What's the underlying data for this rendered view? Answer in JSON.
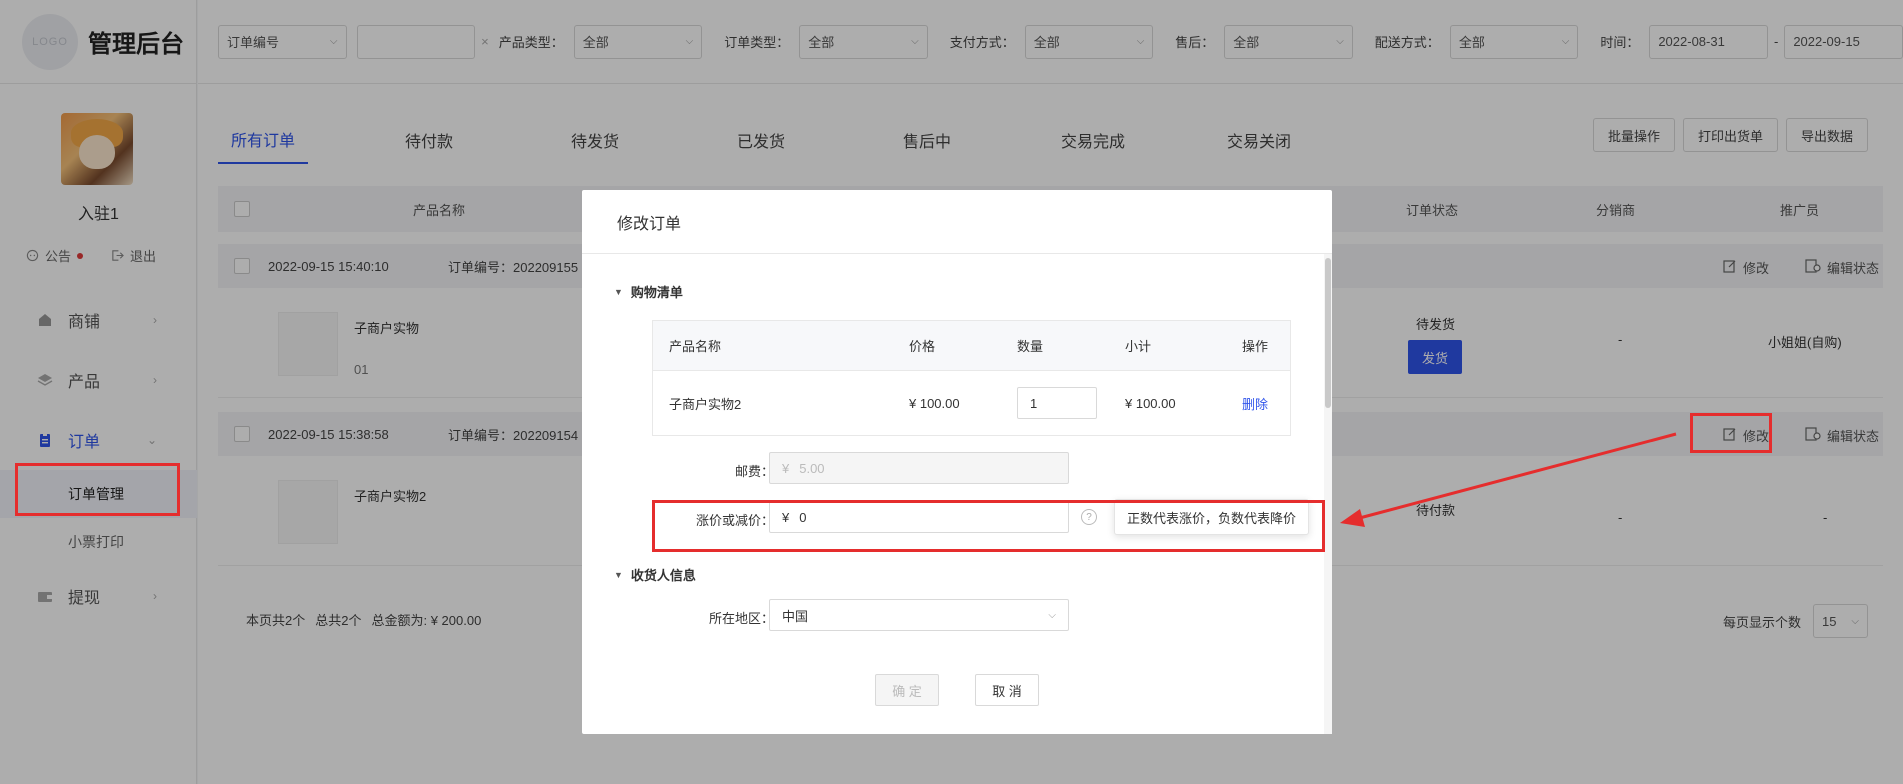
{
  "brand": {
    "logo_text": "LOGO",
    "title": "管理后台"
  },
  "user": {
    "name": "入驻1",
    "notice_label": "公告",
    "logout_label": "退出"
  },
  "nav": {
    "shop": "商铺",
    "product": "产品",
    "order": "订单",
    "order_manage": "订单管理",
    "receipt_print": "小票打印",
    "withdraw": "提现"
  },
  "filters": {
    "order_no_select": "订单编号",
    "order_no_value": "",
    "clear": "×",
    "product_type_label": "产品类型：",
    "product_type_value": "全部",
    "order_type_label": "订单类型：",
    "order_type_value": "全部",
    "pay_label": "支付方式：",
    "pay_value": "全部",
    "after_sale_label": "售后：",
    "after_sale_value": "全部",
    "delivery_label": "配送方式：",
    "delivery_value": "全部",
    "time_label": "时间：",
    "date_from": "2022-08-31",
    "date_sep": "-",
    "date_to": "2022-09-15"
  },
  "tabs": [
    "所有订单",
    "待付款",
    "待发货",
    "已发货",
    "售后中",
    "交易完成",
    "交易关闭"
  ],
  "actions": {
    "batch": "批量操作",
    "print_ship": "打印出货单",
    "export": "导出数据"
  },
  "table": {
    "col_product": "产品名称",
    "col_status": "订单状态",
    "col_distributor": "分销商",
    "col_promoter": "推广员"
  },
  "orders": [
    {
      "time": "2022-09-15 15:40:10",
      "order_no": "订单编号：202209155",
      "product": "子商户实物",
      "spec": "01",
      "status": "待发货",
      "ship_btn": "发货",
      "distributor": "-",
      "promoter": "小姐姐(自购)",
      "edit": "修改",
      "edit_status": "编辑状态"
    },
    {
      "time": "2022-09-15 15:38:58",
      "order_no": "订单编号：202209154",
      "product": "子商户实物2",
      "status": "待付款",
      "distributor": "-",
      "promoter": "-",
      "edit": "修改",
      "edit_status": "编辑状态"
    }
  ],
  "footer": {
    "page_count": "本页共2个",
    "total_count": "总共2个",
    "total_amount": "总金额为: ¥ 200.00",
    "per_page_label": "每页显示个数",
    "per_page_value": "15"
  },
  "modal": {
    "title": "修改订单",
    "cart_section": "购物清单",
    "cart_headers": {
      "name": "产品名称",
      "price": "价格",
      "qty": "数量",
      "subtotal": "小计",
      "op": "操作"
    },
    "cart_row": {
      "name": "子商户实物2",
      "price": "¥ 100.00",
      "qty": "1",
      "subtotal": "¥ 100.00",
      "delete": "删除"
    },
    "shipping_label": "邮费：",
    "shipping_value": "5.00",
    "adjust_label": "涨价或减价：",
    "adjust_value": "0",
    "currency": "¥",
    "help": "?",
    "tooltip": "正数代表涨价，负数代表降价",
    "receiver_section": "收货人信息",
    "region_label": "所在地区：",
    "region_value": "中国",
    "confirm": "确 定",
    "cancel": "取 消"
  },
  "colors": {
    "accent": "#2f54eb",
    "annotation": "#e52d2d"
  }
}
